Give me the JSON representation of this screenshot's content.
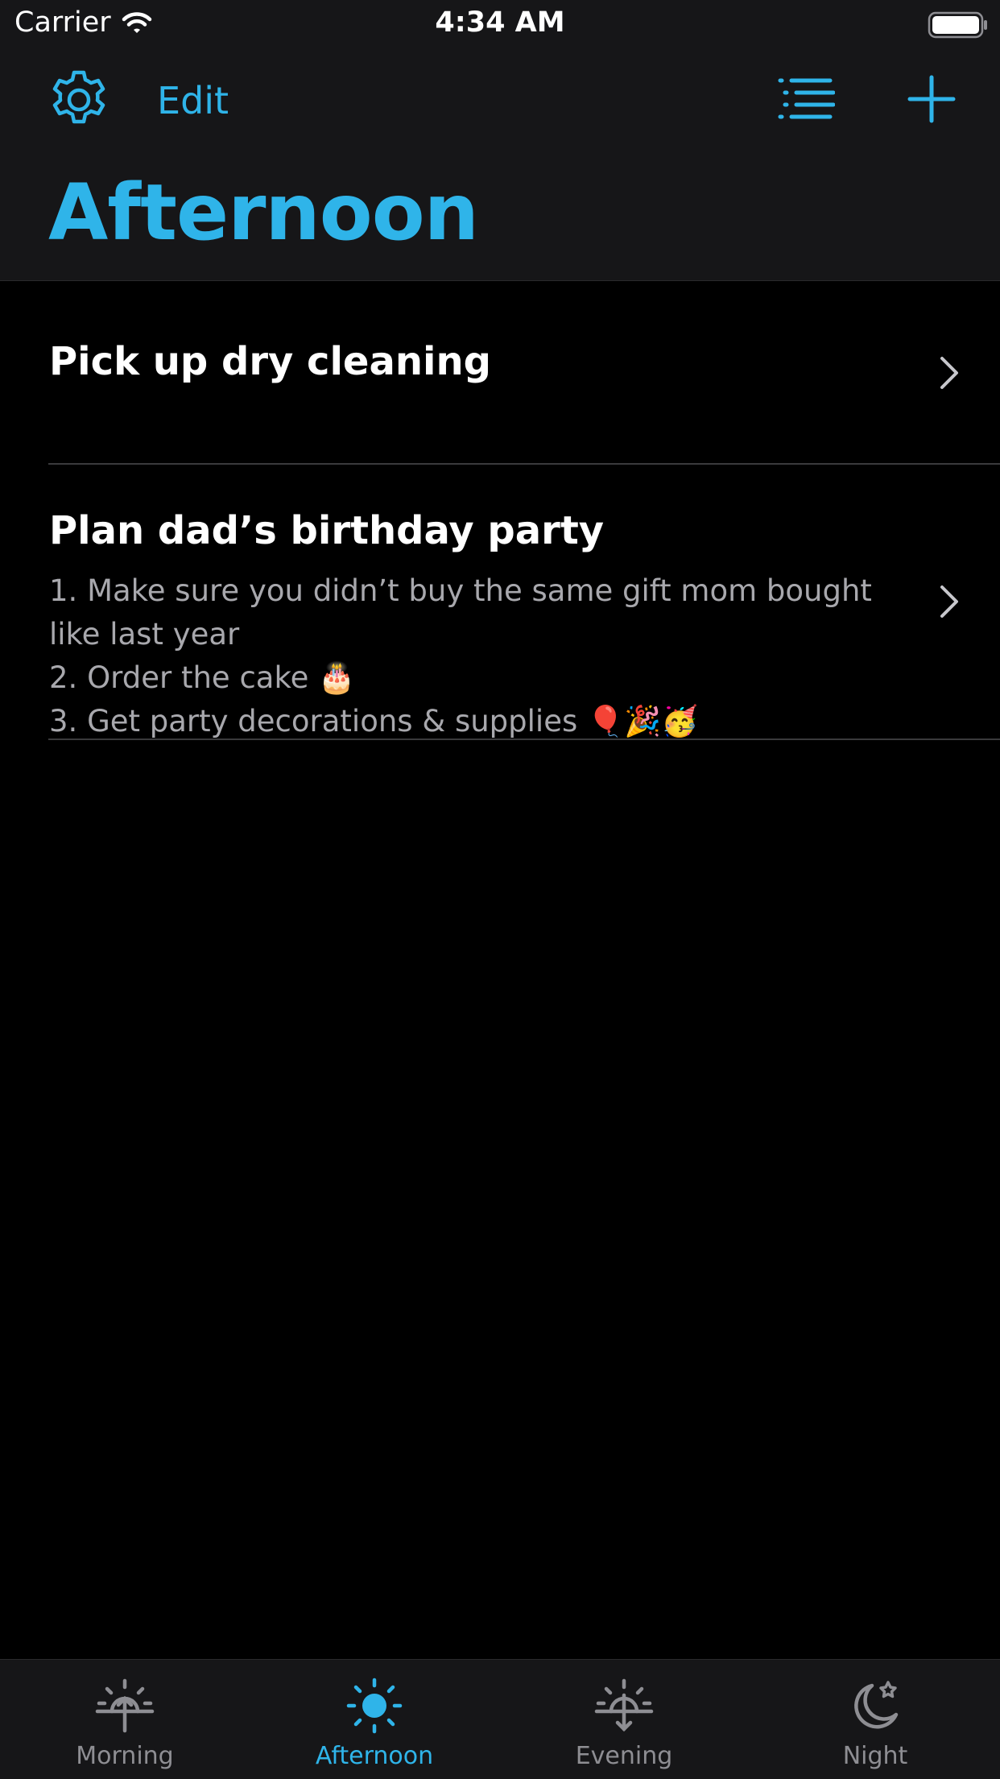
{
  "status_bar": {
    "carrier": "Carrier",
    "time": "4:34 AM"
  },
  "nav": {
    "edit_label": "Edit",
    "title": "Afternoon",
    "settings_icon": "gear-icon",
    "list_icon": "list-icon",
    "add_icon": "plus-icon"
  },
  "tasks": [
    {
      "title": "Pick up dry cleaning",
      "notes": []
    },
    {
      "title": "Plan dad’s birthday party",
      "notes": [
        "1. Make sure you didn’t buy the same gift mom bought",
        "like last year",
        "2. Order the cake 🎂",
        "3. Get party decorations & supplies 🎈🎉🥳"
      ]
    }
  ],
  "tabs": [
    {
      "label": "Morning",
      "icon": "sunrise-icon",
      "active": false
    },
    {
      "label": "Afternoon",
      "icon": "sun-icon",
      "active": true
    },
    {
      "label": "Evening",
      "icon": "sunset-icon",
      "active": false
    },
    {
      "label": "Night",
      "icon": "moon-stars-icon",
      "active": false
    }
  ],
  "colors": {
    "accent": "#2fb4e9",
    "background": "#000000",
    "bar_background": "#161618",
    "secondary_text": "#a8a8ad",
    "inactive_tab": "#8e8e93"
  }
}
